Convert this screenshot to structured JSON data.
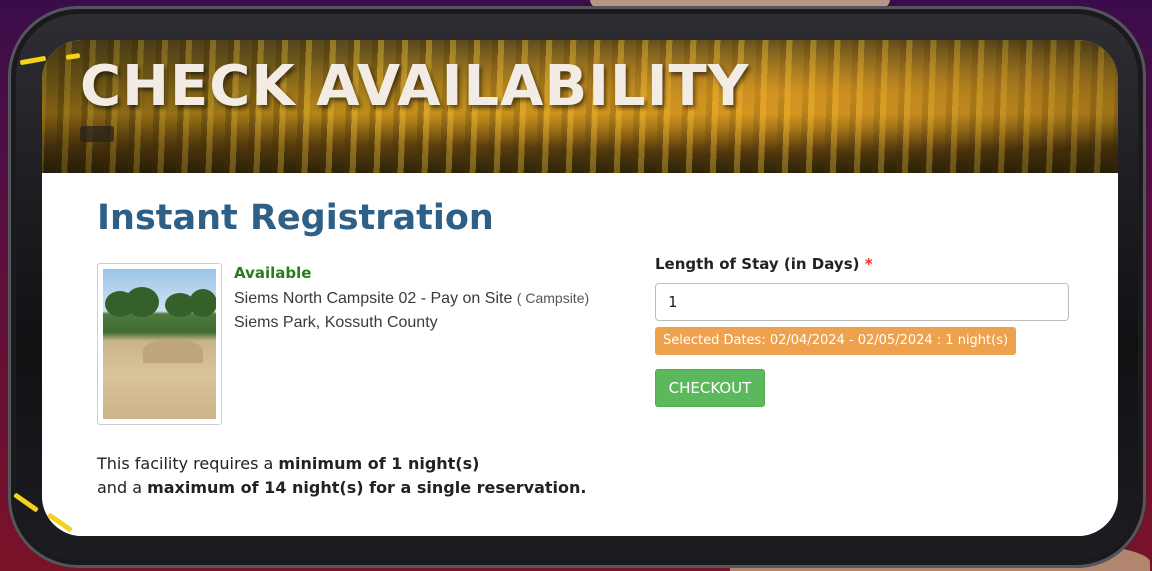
{
  "banner": {
    "title": "CHECK AVAILABILITY"
  },
  "page": {
    "title": "Instant Registration"
  },
  "site": {
    "status": "Available",
    "name": "Siems North Campsite 02 - Pay on Site",
    "type": "( Campsite)",
    "location": "Siems Park, Kossuth County"
  },
  "policy": {
    "line1_prefix": "This facility requires a ",
    "line1_bold": "minimum of 1 night(s)",
    "line2_prefix": "and a ",
    "line2_bold": "maximum of 14 night(s) for a single reservation."
  },
  "form": {
    "stay_label": "Length of Stay (in Days)",
    "required_mark": "*",
    "stay_value": "1",
    "selected_dates": "Selected Dates: 02/04/2024 - 02/05/2024 : 1 night(s)",
    "checkout_label": "CHECKOUT"
  },
  "colors": {
    "title_blue": "#2d5f87",
    "available_green": "#2b7a1f",
    "badge_orange": "#eea24d",
    "checkout_green": "#5cb85c",
    "required_red": "#d9342b"
  }
}
